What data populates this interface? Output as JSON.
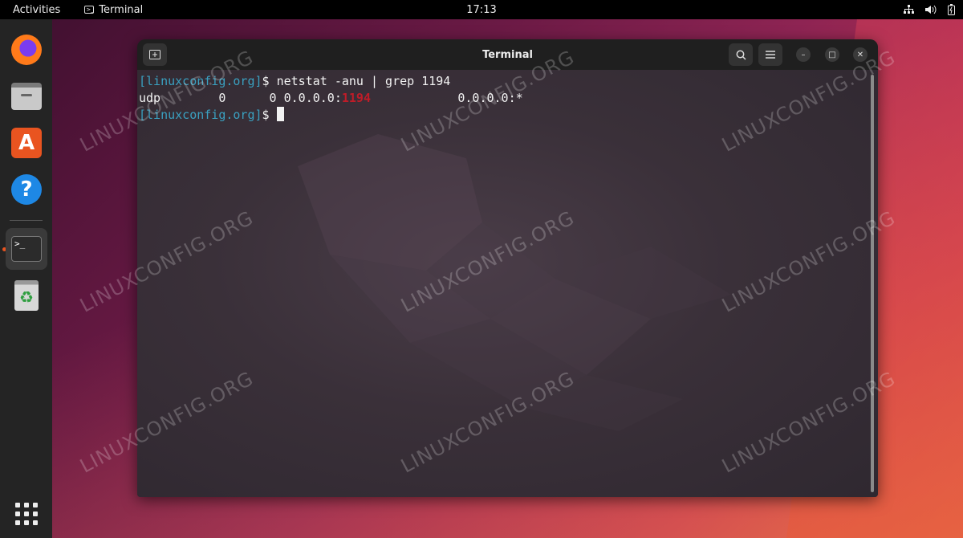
{
  "topbar": {
    "activities": "Activities",
    "app_name": "Terminal",
    "clock": "17:13"
  },
  "dock": {
    "items": [
      "firefox-icon",
      "files-icon",
      "software-store-icon",
      "help-icon",
      "terminal-icon",
      "trash-icon"
    ],
    "show_apps_icon": "grid-icon"
  },
  "window": {
    "title": "Terminal"
  },
  "terminal": {
    "line1_prompt": "[linuxconfig.org]",
    "line1_cmd": "$ netstat -anu | grep 1194",
    "line2_pre": "udp        0      0 0.0.0.0:",
    "line2_port": "1194",
    "line2_post": "            0.0.0.0:*",
    "line3_prompt": "[linuxconfig.org]",
    "line3_cmd": "$ "
  },
  "watermark": "LINUXCONFIG.ORG",
  "colors": {
    "prompt": "#3aa0c0",
    "highlight": "#c01c28",
    "accent": "#e95420"
  }
}
